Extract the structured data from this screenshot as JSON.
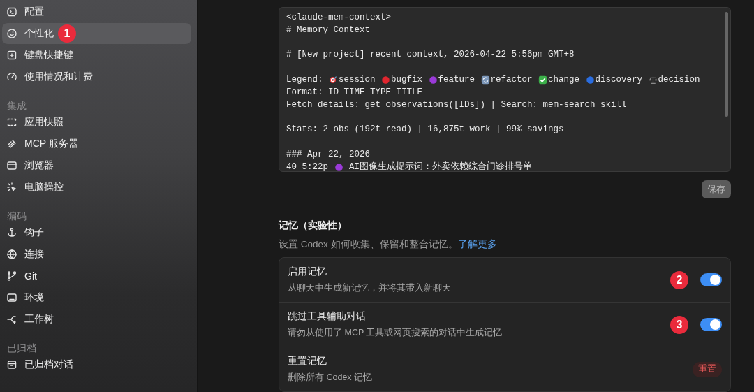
{
  "sidebar": {
    "groups": [
      {
        "items": [
          {
            "label": "配置",
            "selected": false
          },
          {
            "label": "个性化",
            "selected": true,
            "badge": "1"
          },
          {
            "label": "键盘快捷键",
            "selected": false
          },
          {
            "label": "使用情况和计费",
            "selected": false
          }
        ]
      },
      {
        "heading": "集成",
        "items": [
          {
            "label": "应用快照",
            "selected": false
          },
          {
            "label": "MCP 服务器",
            "selected": false
          },
          {
            "label": "浏览器",
            "selected": false
          },
          {
            "label": "电脑操控",
            "selected": false
          }
        ]
      },
      {
        "heading": "编码",
        "items": [
          {
            "label": "钩子",
            "selected": false
          },
          {
            "label": "连接",
            "selected": false
          },
          {
            "label": "Git",
            "selected": false
          },
          {
            "label": "环境",
            "selected": false
          },
          {
            "label": "工作树",
            "selected": false
          }
        ]
      },
      {
        "heading": "已归档",
        "items": [
          {
            "label": "已归档对话",
            "selected": false
          }
        ]
      }
    ]
  },
  "editor": {
    "lines": [
      {
        "kind": "text",
        "text": "<claude-mem-context>"
      },
      {
        "kind": "text",
        "text": "# Memory Context"
      },
      {
        "kind": "text",
        "gap_before": true,
        "text": "# [New project] recent context, 2026-04-22 5:56pm GMT+8"
      },
      {
        "kind": "legend",
        "gap_before": true,
        "text": "Legend:",
        "items": [
          {
            "kind": "session",
            "label": "session"
          },
          {
            "kind": "bugfix",
            "label": "bugfix"
          },
          {
            "kind": "feature",
            "label": "feature"
          },
          {
            "kind": "refactor",
            "label": "refactor"
          },
          {
            "kind": "change",
            "label": "change"
          },
          {
            "kind": "discovery",
            "label": "discovery"
          },
          {
            "kind": "decision",
            "label": "decision"
          }
        ]
      },
      {
        "kind": "text",
        "text": "Format: ID TIME TYPE TITLE"
      },
      {
        "kind": "text",
        "text": "Fetch details: get_observations([IDs]) | Search: mem-search skill"
      },
      {
        "kind": "text",
        "gap_before": true,
        "text": "Stats: 2 obs (192t read) | 16,875t work | 99% savings"
      },
      {
        "kind": "text",
        "gap_before": true,
        "text": "### Apr 22, 2026"
      },
      {
        "kind": "entry",
        "prefix": "40 5:22p",
        "marker": {
          "kind": "feature"
        },
        "text": "AI图像生成提示词：外卖依赖综合门诊排号单"
      }
    ],
    "save_button": "保存"
  },
  "memory": {
    "title": "记忆（实验性）",
    "description": "设置 Codex 如何收集、保留和整合记忆。",
    "link": "了解更多",
    "rows": [
      {
        "kind": "toggle",
        "title": "启用记忆",
        "description": "从聊天中生成新记忆，并将其带入新聊天",
        "badge": "2",
        "on": true
      },
      {
        "kind": "toggle",
        "title": "跳过工具辅助对话",
        "description": "请勿从使用了 MCP 工具或网页搜索的对话中生成记忆",
        "badge": "3",
        "on": true
      },
      {
        "kind": "action",
        "title": "重置记忆",
        "description": "删除所有 Codex 记忆",
        "button": "重置"
      }
    ]
  }
}
